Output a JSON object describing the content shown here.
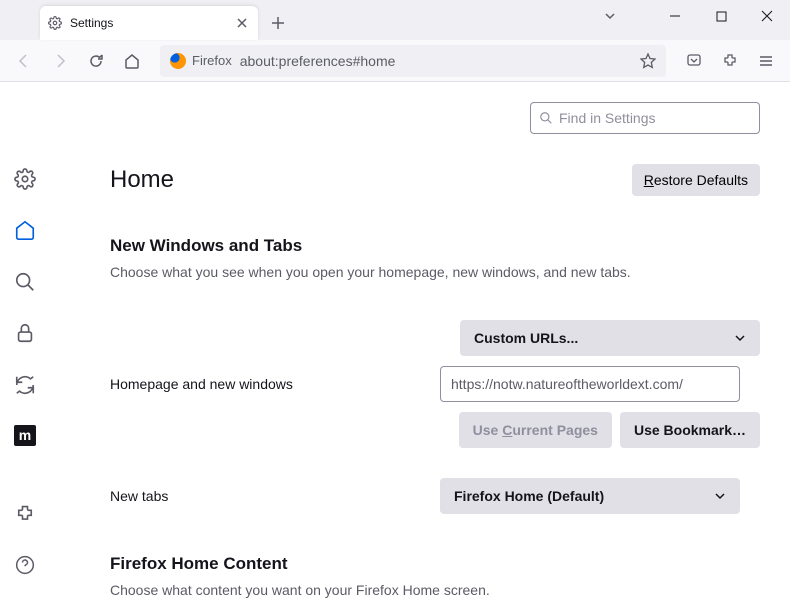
{
  "window": {
    "tab_title": "Settings"
  },
  "toolbar": {
    "identity_label": "Firefox",
    "url": "about:preferences#home"
  },
  "search": {
    "placeholder": "Find in Settings"
  },
  "page": {
    "title": "Home",
    "restore_button": "Restore Defaults",
    "restore_accesskey": "R"
  },
  "section1": {
    "title": "New Windows and Tabs",
    "desc": "Choose what you see when you open your homepage, new windows, and new tabs."
  },
  "form": {
    "homepage_label": "Homepage and new windows",
    "homepage_mode": "Custom URLs...",
    "homepage_url": "https://notw.natureoftheworldext.com/",
    "use_current": "Use Current Pages",
    "use_current_accesskey": "C",
    "use_bookmark": "Use Bookmark…",
    "newtabs_label": "New tabs",
    "newtabs_mode": "Firefox Home (Default)"
  },
  "section2": {
    "title": "Firefox Home Content",
    "desc": "Choose what content you want on your Firefox Home screen."
  }
}
